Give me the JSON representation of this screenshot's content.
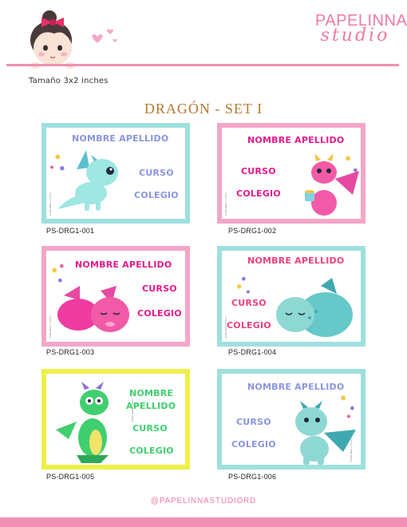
{
  "header": {
    "size_note": "Tamaño 3x2 inches",
    "brand_line1": "PAPELINNA",
    "brand_line2": "studio",
    "brand_color": "#f07aa3"
  },
  "set_title": "DRAGÓN - SET I",
  "cards": [
    {
      "name": "NOMBRE APELLIDO",
      "curso": "CURSO",
      "colegio": "COLEGIO",
      "code": "PS-DRG1-001",
      "border": "#9ee0de",
      "text_color": "#8a95e0"
    },
    {
      "name": "NOMBRE APELLIDO",
      "curso": "CURSO",
      "colegio": "COLEGIO",
      "code": "PS-DRG1-002",
      "border": "#f4a6c8",
      "text_color": "#e51a8c"
    },
    {
      "name": "NOMBRE APELLIDO",
      "curso": "CURSO",
      "colegio": "COLEGIO",
      "code": "PS-DRG1-003",
      "border": "#f4a6c8",
      "text_color": "#e51a8c"
    },
    {
      "name": "NOMBRE APELLIDO",
      "curso": "CURSO",
      "colegio": "COLEGIO",
      "code": "PS-DRG1-004",
      "border": "#9ee0de",
      "text_color": "#f0407f"
    },
    {
      "name_line1": "NOMBRE",
      "name_line2": "APELLIDO",
      "curso": "CURSO",
      "colegio": "COLEGIO",
      "code": "PS-DRG1-005",
      "border": "#eef04a",
      "text_color": "#3fcf6e"
    },
    {
      "name": "NOMBRE APELLIDO",
      "curso": "CURSO",
      "colegio": "COLEGIO",
      "code": "PS-DRG1-006",
      "border": "#9ee0de",
      "text_color": "#8a95e0"
    }
  ],
  "footer": {
    "handle": "@PAPELINNASTUDIORD"
  }
}
